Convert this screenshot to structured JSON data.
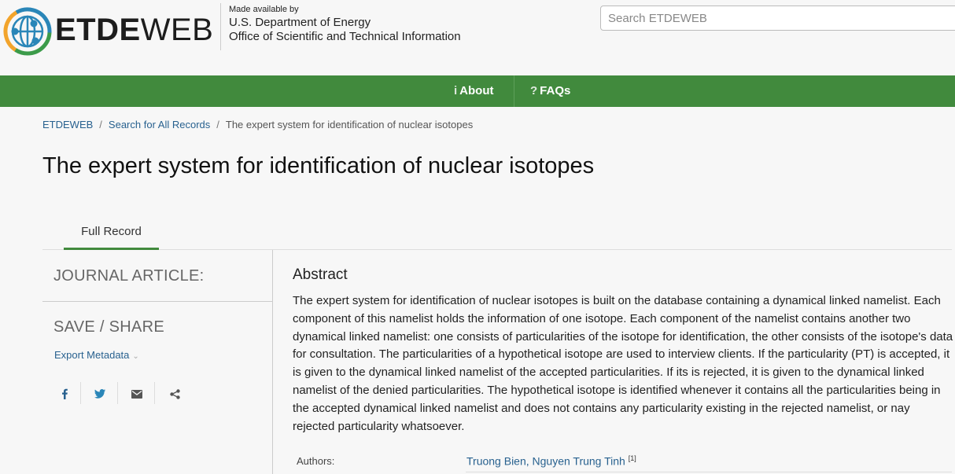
{
  "header": {
    "logo_bold": "ETDE",
    "logo_thin": "WEB",
    "made_available": "Made available by",
    "org_line1": "U.S. Department of Energy",
    "org_line2": "Office of Scientific and Technical Information",
    "search_placeholder": "Search ETDEWEB"
  },
  "nav": {
    "about": "About",
    "faqs": "FAQs",
    "about_icon": "info-icon",
    "faqs_icon": "question-icon"
  },
  "breadcrumb": {
    "home": "ETDEWEB",
    "search": "Search for All Records",
    "current": "The expert system for identification of nuclear isotopes"
  },
  "page": {
    "title": "The expert system for identification of nuclear isotopes"
  },
  "tabs": {
    "full_record": "Full Record"
  },
  "sidebar": {
    "type_heading": "JOURNAL ARTICLE:",
    "save_heading": "SAVE / SHARE",
    "export_label": "Export Metadata",
    "share_icons": [
      "facebook-icon",
      "twitter-icon",
      "email-icon",
      "share-icon"
    ]
  },
  "abstract": {
    "heading": "Abstract",
    "text": "The expert system for identification of nuclear isotopes is built on the database containing a dynamical linked namelist. Each component of this namelist holds the information of one isotope. Each component of the namelist contains another two dynamical linked namelist: one consists of particularities of the isotope for identification, the other consists of the isotope's data for consultation. The particularities of a hypothetical isotope are used to interview clients. If the particularity (PT) is accepted, it is given to the dynamical linked namelist of the accepted particularities. If its is rejected, it is given to the dynamical linked namelist of the denied particularities. The hypothetical isotope is identified whenever it contains all the particularities being in the accepted dynamical linked namelist and does not contains any particularity existing in the rejected namelist, or nay rejected particularity whatsoever."
  },
  "record": {
    "authors_label": "Authors:",
    "authors_value": "Truong Bien, Nguyen Trung Tinh",
    "authors_ref": "[1]"
  },
  "colors": {
    "nav_green": "#418a3d",
    "link_blue": "#28618f"
  }
}
